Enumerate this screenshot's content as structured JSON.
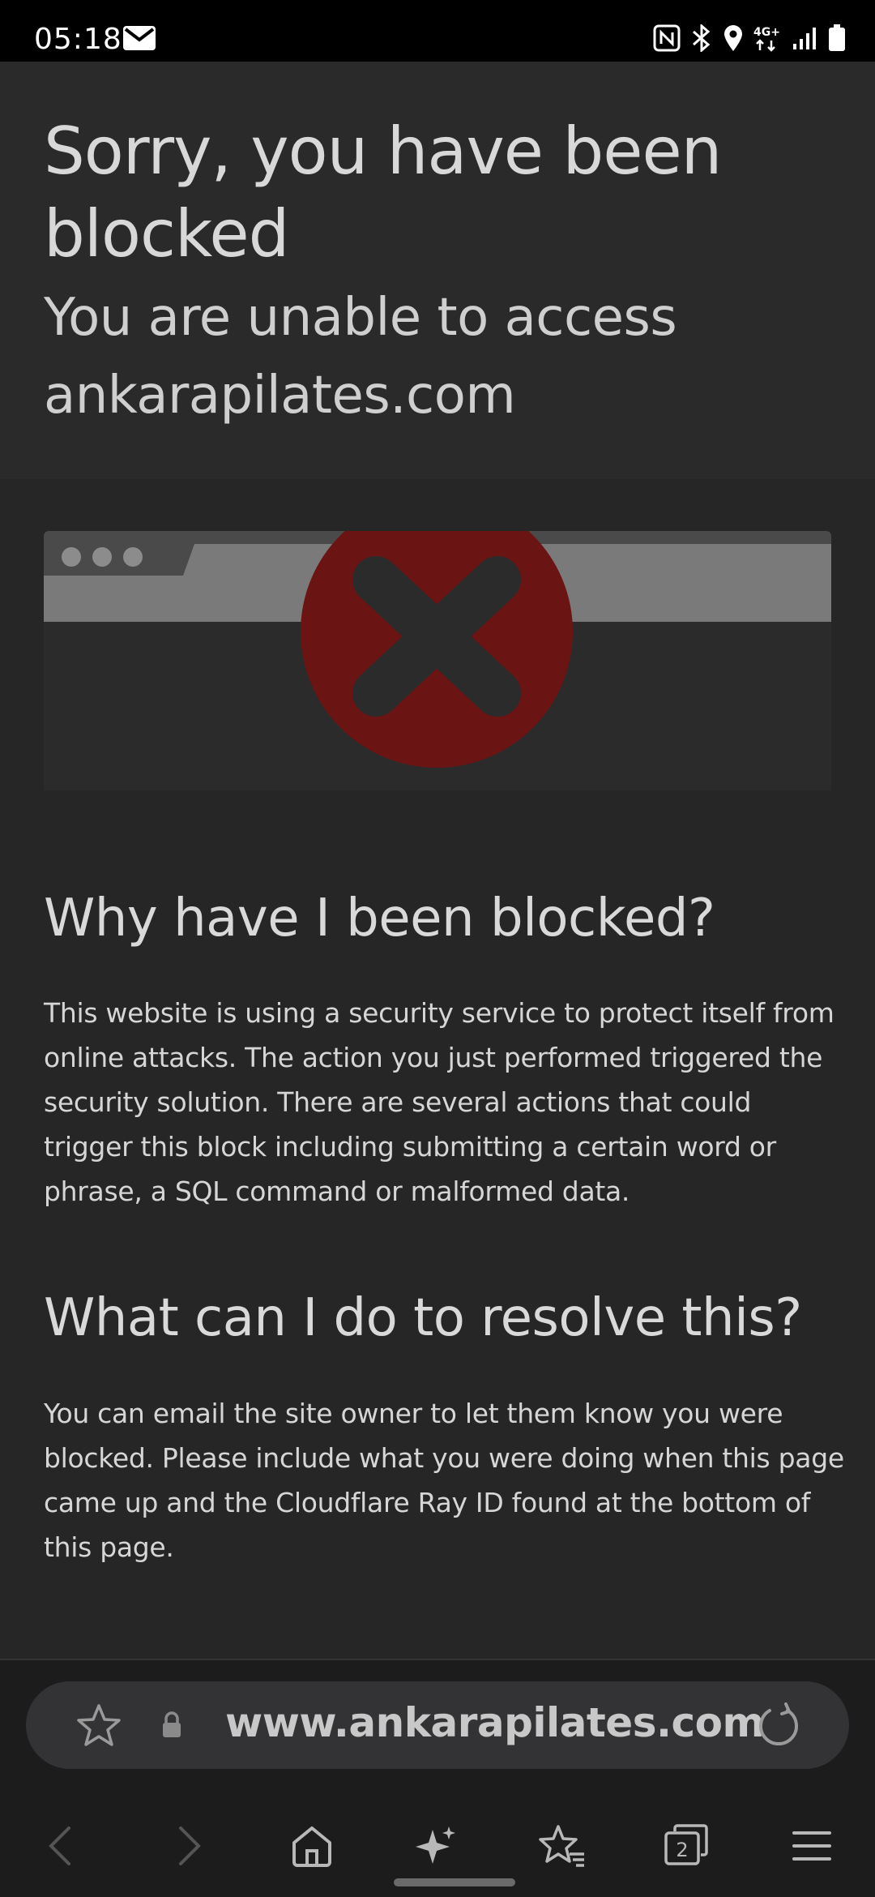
{
  "status_bar": {
    "time": "05:18",
    "icons": [
      "mail-icon",
      "nfc-icon",
      "bluetooth-icon",
      "location-icon",
      "4g-icon",
      "signal-icon",
      "battery-icon"
    ],
    "network_label": "4G+"
  },
  "page": {
    "title": "Sorry, you have been blocked",
    "subtitle": "You are unable to access ankarapilates.com",
    "section1": {
      "heading": "Why have I been blocked?",
      "body": "This website is using a security service to protect itself from online attacks. The action you just performed triggered the security solution. There are several actions that could trigger this block including submitting a certain word or phrase, a SQL command or malformed data."
    },
    "section2": {
      "heading": "What can I do to resolve this?",
      "body": "You can email the site owner to let them know you were blocked. Please include what you were doing when this page came up and the Cloudflare Ray ID found at the bottom of this page."
    },
    "colors": {
      "error_red": "#6b1414",
      "background": "#262626"
    }
  },
  "browser": {
    "url": "www.ankarapilates.com",
    "tab_count": "2",
    "nav_icons": [
      "back-icon",
      "forward-icon",
      "home-icon",
      "sparkle-icon",
      "bookmarks-icon",
      "tabs-icon",
      "menu-icon"
    ]
  }
}
